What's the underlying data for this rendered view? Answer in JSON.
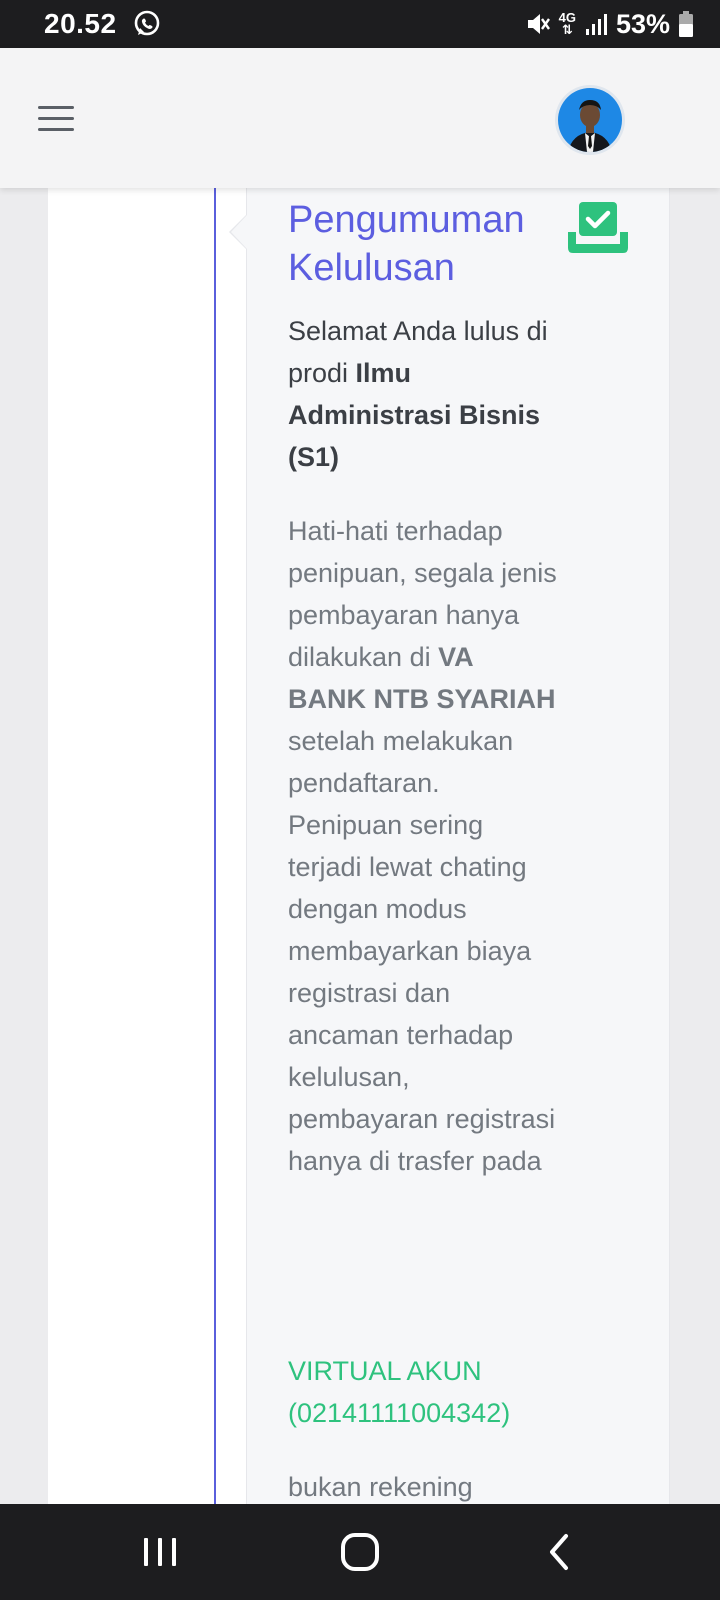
{
  "status_bar": {
    "time": "20.52",
    "network": "4G",
    "battery": "53%",
    "icons": [
      "whatsapp-icon",
      "mute-icon",
      "signal-icon",
      "battery-icon"
    ]
  },
  "app_bar": {
    "menu_icon": "hamburger-menu-icon",
    "avatar": "profile-avatar"
  },
  "announcement": {
    "title": "Pengumuman Kelulusan",
    "icon": "inbox-check-icon",
    "greeting_prefix": "Selamat Anda lulus di prodi ",
    "program": "Ilmu Administrasi Bisnis (S1)",
    "warning_part1": "Hati-hati terhadap penipuan, segala jenis pembayaran hanya dilakukan di ",
    "bank": "VA BANK NTB SYARIAH",
    "warning_part2": " setelah melakukan pendaftaran. Penipuan sering terjadi lewat chating dengan modus membayarkan biaya registrasi dan ancaman terhadap kelulusan, pembayaran registrasi hanya di trasfer pada",
    "virtual_account": "VIRTUAL AKUN (02141111004342)",
    "tail": "bukan rekening"
  },
  "colors": {
    "title": "#5c5ee0",
    "timeline": "#5a5fdc",
    "success": "#2ec27e",
    "muted_text": "#737980",
    "body_text": "#3b3f45"
  },
  "nav_bar": {
    "buttons": [
      "recent-apps-icon",
      "home-icon",
      "back-icon"
    ]
  }
}
